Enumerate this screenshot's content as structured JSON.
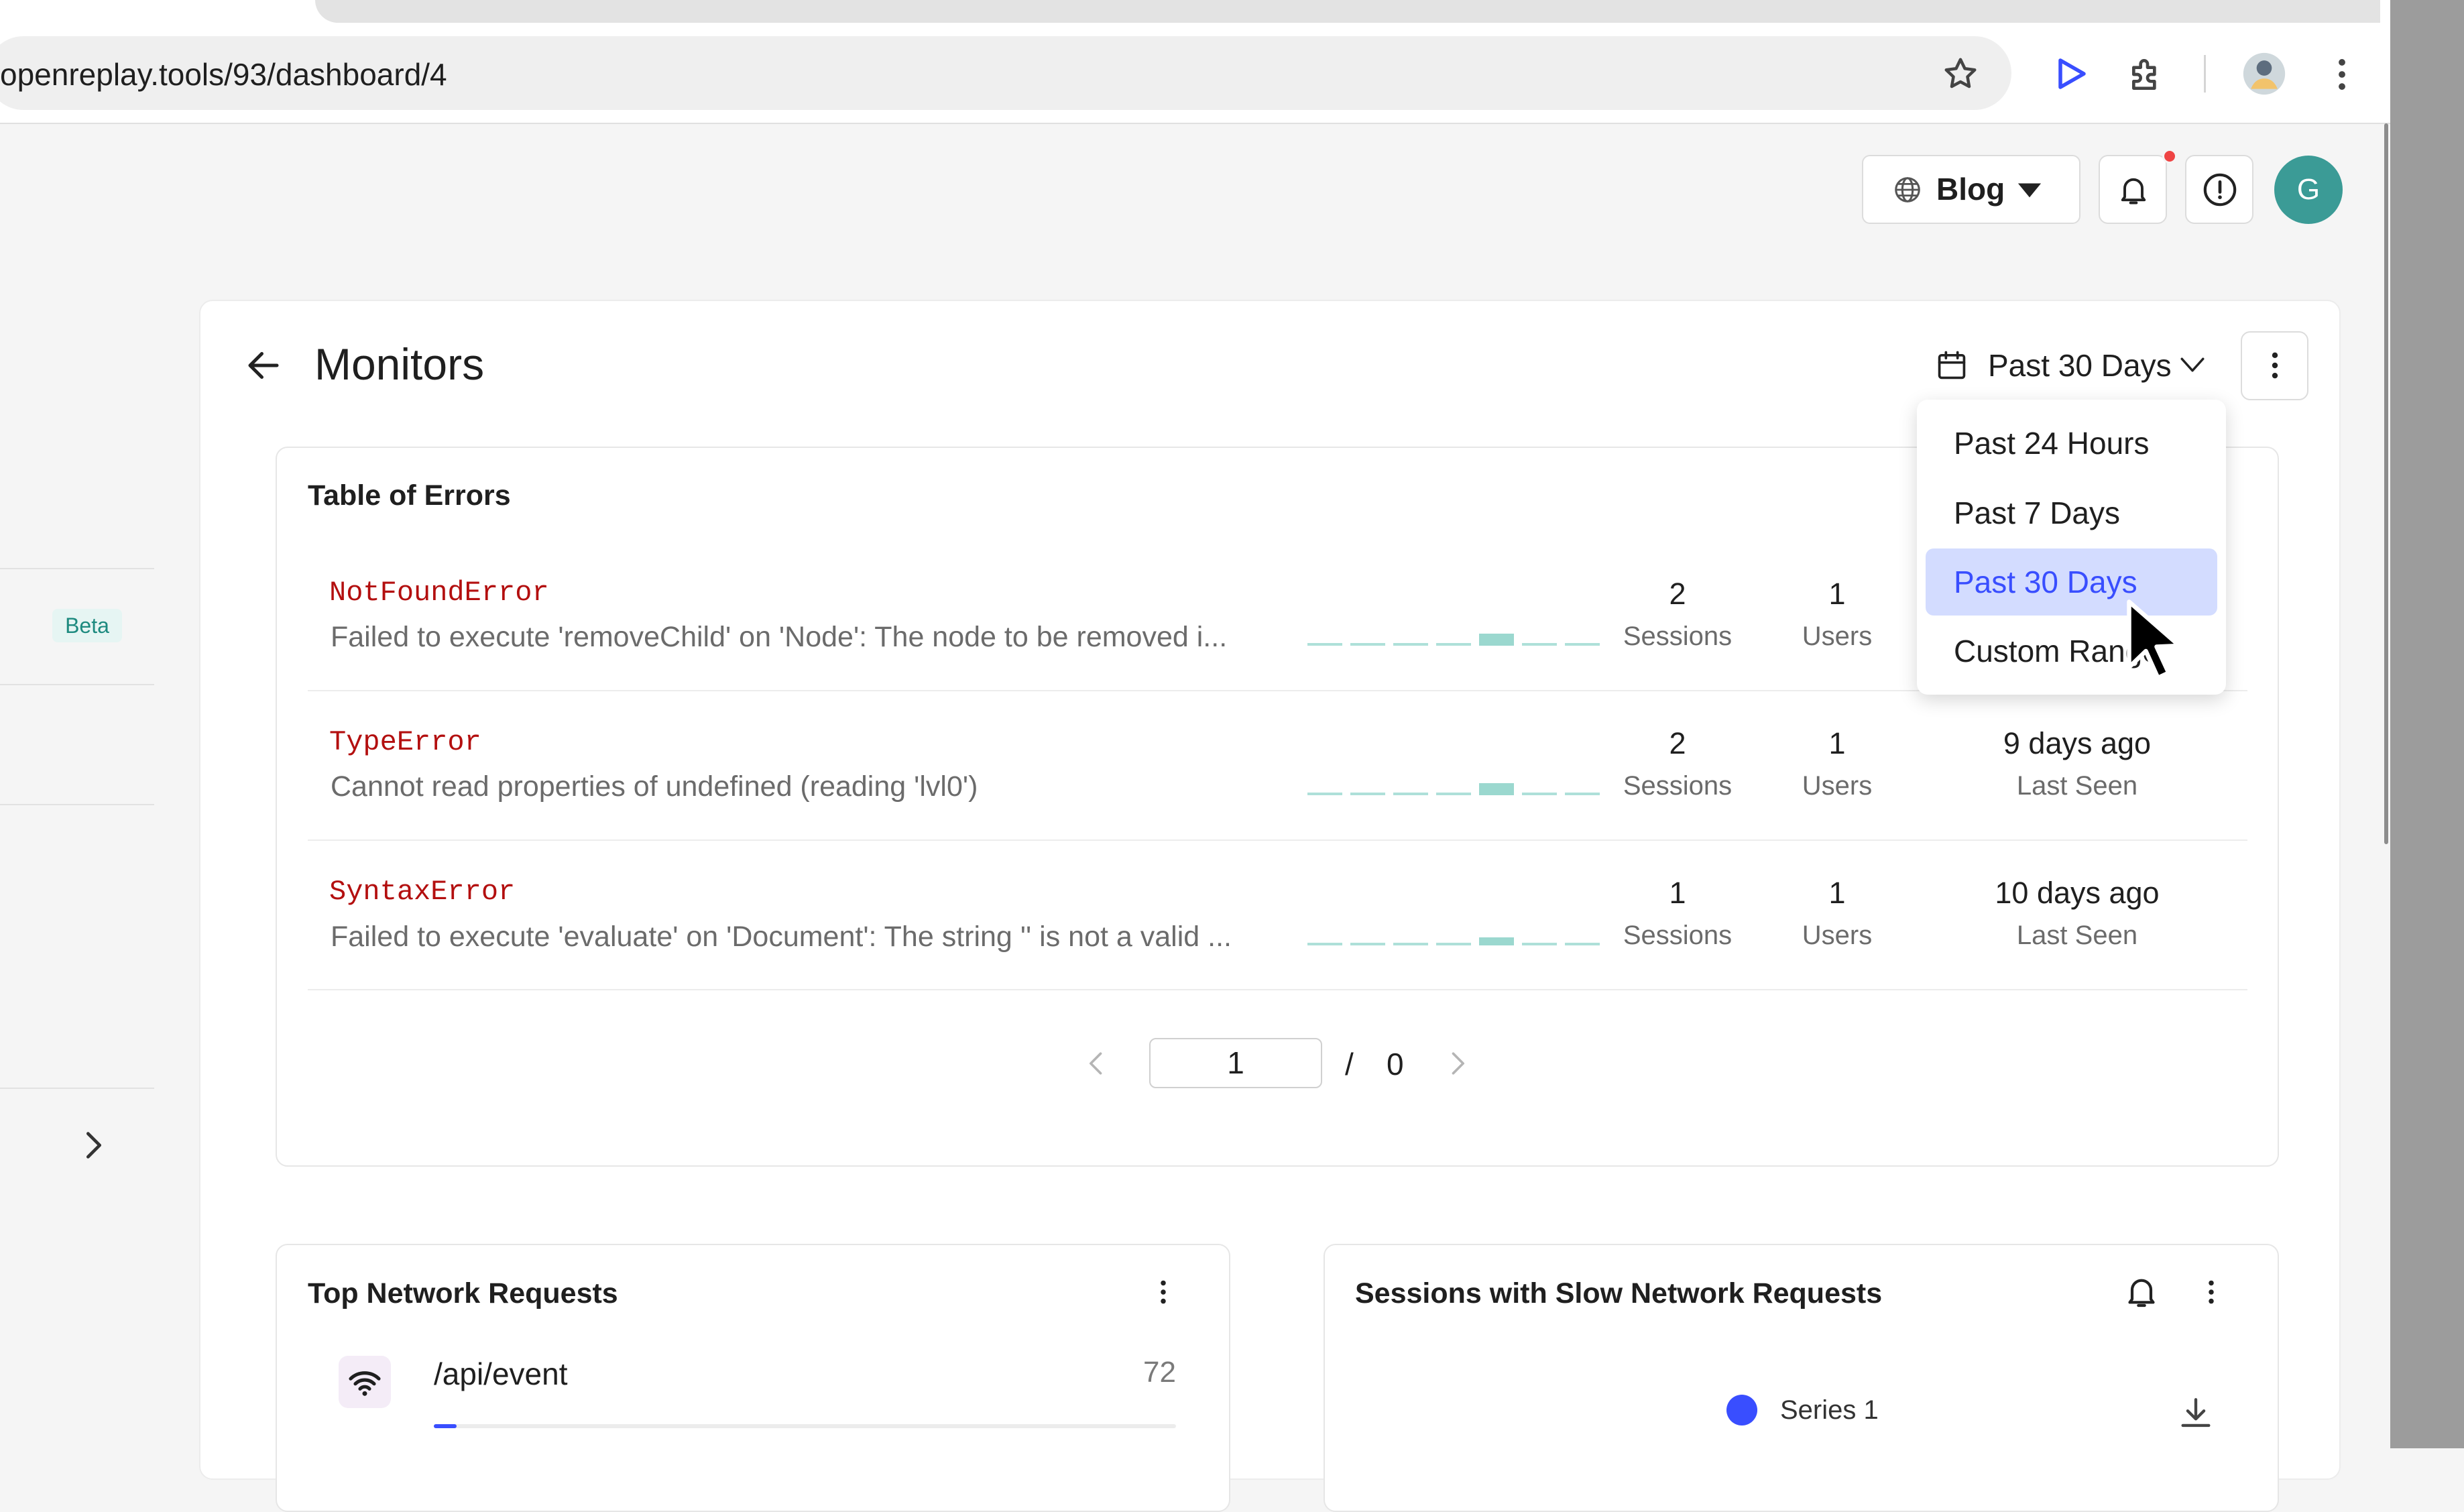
{
  "browser": {
    "url": "openreplay.tools/93/dashboard/4"
  },
  "header": {
    "project_label": "Blog",
    "avatar_initial": "G",
    "notification_dot_color": "#ef4444"
  },
  "sidebar": {
    "beta_label": "Beta"
  },
  "dashboard": {
    "title": "Monitors",
    "date_range_label": "Past 30 Days"
  },
  "date_dropdown": {
    "options": [
      {
        "label": "Past 24 Hours",
        "selected": false
      },
      {
        "label": "Past 7 Days",
        "selected": false
      },
      {
        "label": "Past 30 Days",
        "selected": true
      },
      {
        "label": "Custom Range",
        "selected": false
      }
    ]
  },
  "errors_widget": {
    "title": "Table of Errors",
    "sessions_label": "Sessions",
    "users_label": "Users",
    "last_seen_label": "Last Seen",
    "rows": [
      {
        "name": "NotFoundError",
        "message": "Failed to execute 'removeChild' on 'Node': The node to be removed i...",
        "sessions": "2",
        "users": "1",
        "last_seen": ""
      },
      {
        "name": "TypeError",
        "message": "Cannot read properties of undefined (reading 'lvl0')",
        "sessions": "2",
        "users": "1",
        "last_seen": "9 days ago"
      },
      {
        "name": "SyntaxError",
        "message": "Failed to execute 'evaluate' on 'Document': The string '' is not a valid ...",
        "sessions": "1",
        "users": "1",
        "last_seen": "10 days ago"
      }
    ],
    "pagination": {
      "current_page": "1",
      "separator": "/",
      "total_pages": "0"
    }
  },
  "network_widget": {
    "title": "Top Network Requests",
    "items": [
      {
        "path": "/api/event",
        "count": "72"
      }
    ]
  },
  "slow_widget": {
    "title": "Sessions with Slow Network Requests",
    "legend": [
      {
        "label": "Series 1",
        "color": "#394eff"
      }
    ]
  },
  "colors": {
    "accent": "#394eff",
    "error_name": "#b30f0f",
    "sparkline": "#9bd8cf",
    "avatar": "#3b9b96"
  }
}
